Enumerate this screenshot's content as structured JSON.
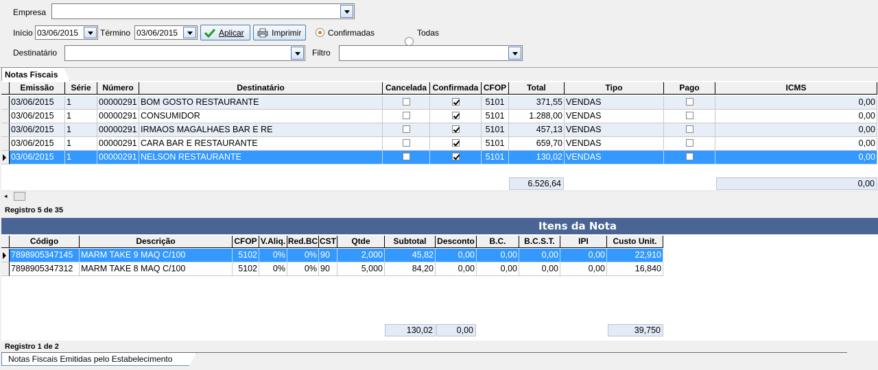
{
  "filters": {
    "empresa_label": "Empresa",
    "empresa_value": "",
    "inicio_label": "Início",
    "inicio_value": "03/06/2015",
    "termino_label": "Término",
    "termino_value": "03/06/2015",
    "aplicar_label": "Aplicar",
    "imprimir_label": "Imprimir",
    "confirmadas_label": "Confirmadas",
    "todas_label": "Todas",
    "confirmadas_selected": true,
    "destinatario_label": "Destinatário",
    "destinatario_value": "",
    "filtro_label": "Filtro",
    "filtro_value": ""
  },
  "notas": {
    "tab_label": "Notas Fiscais",
    "columns": [
      "Emissão",
      "Série",
      "Número",
      "Destinatário",
      "Cancelada",
      "Confirmada",
      "CFOP",
      "Total",
      "Tipo",
      "Pago",
      "ICMS"
    ],
    "rows": [
      {
        "emissao": "03/06/2015",
        "serie": "1",
        "numero": "00000291",
        "destinatario": "BOM GOSTO RESTAURANTE",
        "cancelada": false,
        "confirmada": true,
        "cfop": "5101",
        "total": "371,55",
        "tipo": "VENDAS",
        "pago": false,
        "icms": "0,00"
      },
      {
        "emissao": "03/06/2015",
        "serie": "1",
        "numero": "00000291",
        "destinatario": "CONSUMIDOR",
        "cancelada": false,
        "confirmada": true,
        "cfop": "5101",
        "total": "1.288,00",
        "tipo": "VENDAS",
        "pago": false,
        "icms": "0,00"
      },
      {
        "emissao": "03/06/2015",
        "serie": "1",
        "numero": "00000291",
        "destinatario": "IRMAOS MAGALHAES BAR E RE",
        "cancelada": false,
        "confirmada": true,
        "cfop": "5101",
        "total": "457,13",
        "tipo": "VENDAS",
        "pago": false,
        "icms": "0,00"
      },
      {
        "emissao": "03/06/2015",
        "serie": "1",
        "numero": "00000291",
        "destinatario": "CARA BAR E RESTAURANTE",
        "cancelada": false,
        "confirmada": true,
        "cfop": "5101",
        "total": "659,70",
        "tipo": "VENDAS",
        "pago": false,
        "icms": "0,00"
      },
      {
        "emissao": "03/06/2015",
        "serie": "1",
        "numero": "00000291",
        "destinatario": "NELSON RESTAURANTE",
        "cancelada": false,
        "confirmada": true,
        "cfop": "5101",
        "total": "130,02",
        "tipo": "VENDAS",
        "pago": false,
        "icms": "0,00"
      }
    ],
    "total_sum": "6.526,64",
    "icms_sum": "0,00",
    "registro": "Registro 5 de 35"
  },
  "itens": {
    "title": "Itens da Nota",
    "columns": [
      "Código",
      "Descrição",
      "CFOP",
      "V.Aliq.",
      "Red.BC",
      "CST",
      "Qtde",
      "Subtotal",
      "Desconto",
      "B.C.",
      "B.C.S.T.",
      "IPI",
      "Custo Unit."
    ],
    "rows": [
      {
        "codigo": "7898905347145",
        "descricao": "MARM TAKE 9 MAQ C/100",
        "cfop": "5102",
        "valiq": "0%",
        "redbc": "0%",
        "cst": "90",
        "qtde": "2,000",
        "subtotal": "45,82",
        "desconto": "0,00",
        "bc": "0,00",
        "bcst": "0,00",
        "ipi": "0,00",
        "custo": "22,910"
      },
      {
        "codigo": "7898905347312",
        "descricao": "MARM TAKE 8 MAQ C/100",
        "cfop": "5102",
        "valiq": "0%",
        "redbc": "0%",
        "cst": "90",
        "qtde": "5,000",
        "subtotal": "84,20",
        "desconto": "0,00",
        "bc": "0,00",
        "bcst": "0,00",
        "ipi": "0,00",
        "custo": "16,840"
      }
    ],
    "subtotal_sum": "130,02",
    "desconto_sum": "0,00",
    "custo_sum": "39,750",
    "registro": "Registro 1 de 2"
  },
  "bottom_tab": "Notas Fiscais Emitidas pelo Estabelecimento",
  "colors": {
    "selection": "#3399ff",
    "alt_row": "#e8eef7",
    "itens_header": "#4a6494",
    "radio_on": "#e87a00"
  }
}
